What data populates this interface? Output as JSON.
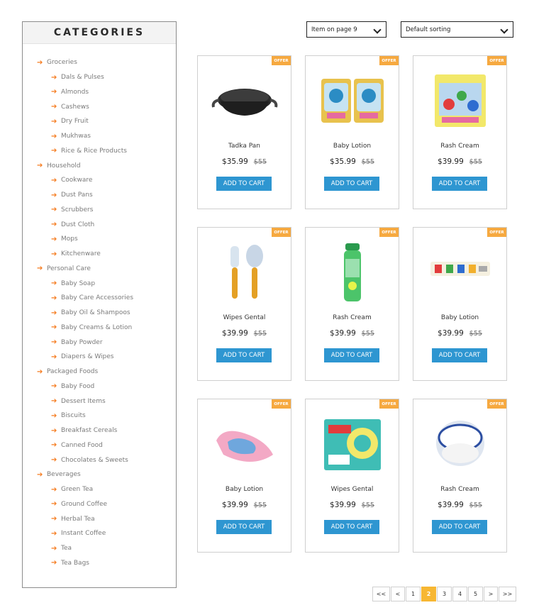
{
  "sidebar": {
    "title": "CATEGORIES",
    "items": [
      {
        "label": "Groceries",
        "level": "parent"
      },
      {
        "label": "Dals & Pulses",
        "level": "child"
      },
      {
        "label": "Almonds",
        "level": "child"
      },
      {
        "label": "Cashews",
        "level": "child"
      },
      {
        "label": "Dry Fruit",
        "level": "child"
      },
      {
        "label": "Mukhwas",
        "level": "child"
      },
      {
        "label": "Rice & Rice Products",
        "level": "child"
      },
      {
        "label": "Household",
        "level": "parent"
      },
      {
        "label": "Cookware",
        "level": "child"
      },
      {
        "label": "Dust Pans",
        "level": "child"
      },
      {
        "label": "Scrubbers",
        "level": "child"
      },
      {
        "label": "Dust Cloth",
        "level": "child"
      },
      {
        "label": "Mops",
        "level": "child"
      },
      {
        "label": "Kitchenware",
        "level": "child"
      },
      {
        "label": "Personal Care",
        "level": "parent"
      },
      {
        "label": "Baby Soap",
        "level": "child"
      },
      {
        "label": "Baby Care Accessories",
        "level": "child"
      },
      {
        "label": "Baby Oil & Shampoos",
        "level": "child"
      },
      {
        "label": "Baby Creams & Lotion",
        "level": "child"
      },
      {
        "label": "Baby Powder",
        "level": "child"
      },
      {
        "label": "Diapers & Wipes",
        "level": "child"
      },
      {
        "label": "Packaged Foods",
        "level": "parent"
      },
      {
        "label": "Baby Food",
        "level": "child"
      },
      {
        "label": "Dessert Items",
        "level": "child"
      },
      {
        "label": "Biscuits",
        "level": "child"
      },
      {
        "label": "Breakfast Cereals",
        "level": "child"
      },
      {
        "label": "Canned Food",
        "level": "child"
      },
      {
        "label": "Chocolates & Sweets",
        "level": "child"
      },
      {
        "label": "Beverages",
        "level": "parent"
      },
      {
        "label": "Green Tea",
        "level": "child"
      },
      {
        "label": "Ground Coffee",
        "level": "child"
      },
      {
        "label": "Herbal Tea",
        "level": "child"
      },
      {
        "label": "Instant Coffee",
        "level": "child"
      },
      {
        "label": "Tea",
        "level": "child"
      },
      {
        "label": "Tea Bags",
        "level": "child"
      }
    ]
  },
  "toolbar": {
    "per_page": "Item on page 9",
    "sorting": "Default sorting"
  },
  "products": [
    {
      "name": "Tadka Pan",
      "price": "$35.99",
      "old_price": "$55",
      "badge": "OFFER",
      "cart_label": "ADD TO CART",
      "icon": "pan-icon"
    },
    {
      "name": "Baby Lotion",
      "price": "$35.99",
      "old_price": "$55",
      "badge": "OFFER",
      "cart_label": "ADD TO CART",
      "icon": "pacifier-pack-icon"
    },
    {
      "name": "Rash Cream",
      "price": "$39.99",
      "old_price": "$55",
      "badge": "OFFER",
      "cart_label": "ADD TO CART",
      "icon": "toy-box-icon"
    },
    {
      "name": "Wipes Gental",
      "price": "$39.99",
      "old_price": "$55",
      "badge": "OFFER",
      "cart_label": "ADD TO CART",
      "icon": "brush-comb-icon"
    },
    {
      "name": "Rash Cream",
      "price": "$39.99",
      "old_price": "$55",
      "badge": "OFFER",
      "cart_label": "ADD TO CART",
      "icon": "bottle-icon"
    },
    {
      "name": "Baby Lotion",
      "price": "$39.99",
      "old_price": "$55",
      "badge": "OFFER",
      "cart_label": "ADD TO CART",
      "icon": "toothpaste-icon"
    },
    {
      "name": "Baby Lotion",
      "price": "$39.99",
      "old_price": "$55",
      "badge": "OFFER",
      "cart_label": "ADD TO CART",
      "icon": "baby-bather-icon"
    },
    {
      "name": "Wipes Gental",
      "price": "$39.99",
      "old_price": "$55",
      "badge": "OFFER",
      "cart_label": "ADD TO CART",
      "icon": "patch-box-icon"
    },
    {
      "name": "Rash Cream",
      "price": "$39.99",
      "old_price": "$55",
      "badge": "OFFER",
      "cart_label": "ADD TO CART",
      "icon": "powder-container-icon"
    }
  ],
  "pagination": {
    "first": "<<",
    "prev": "<",
    "pages": [
      "1",
      "2",
      "3",
      "4",
      "5"
    ],
    "current": "2",
    "next": ">",
    "last": ">>"
  },
  "colors": {
    "accent_orange": "#f57c20",
    "offer_badge": "#f6a940",
    "cart_button": "#2e96d1",
    "active_page": "#f7b733"
  }
}
